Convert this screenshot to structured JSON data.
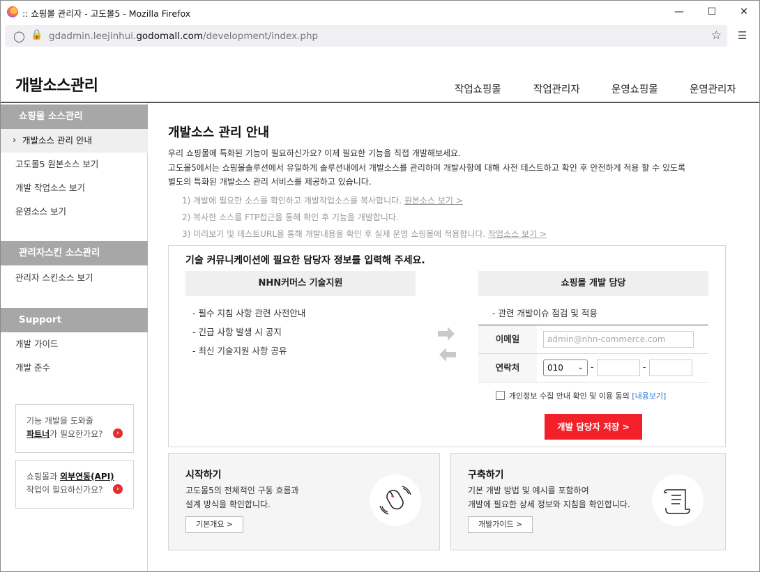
{
  "browser": {
    "window_title": ":: 쇼핑몰 관리자 - 고도몰5 - Mozilla Firefox",
    "url_pre": "gdadmin.leejinhui.",
    "url_domain": "godomall.com",
    "url_post": "/development/index.php"
  },
  "header": {
    "title": "개발소스관리",
    "nav": [
      "작업쇼핑몰",
      "작업관리자",
      "운영쇼핑몰",
      "운영관리자"
    ]
  },
  "sidebar": {
    "section1": "쇼핑몰 소스관리",
    "items1": [
      "개발소스 관리 안내",
      "고도몰5 원본소스 보기",
      "개발 작업소스 보기",
      "운영소스 보기"
    ],
    "section2": "관리자스킨 소스관리",
    "items2": [
      "관리자 스킨소스 보기"
    ],
    "section3": "Support",
    "items3": [
      "개발 가이드",
      "개발 준수"
    ],
    "promo1": {
      "line1": "기능 개발을 도와줄",
      "bold": "파트너",
      "rest": "가 필요한가요?"
    },
    "promo2": {
      "pre": "쇼핑몰과 ",
      "bold": "외부연동(API)",
      "line2": "작업이 필요하신가요?"
    }
  },
  "main": {
    "heading": "개발소스 관리 안내",
    "intro": [
      "우리 쇼핑몰에 특화된 기능이 필요하신가요? 이제 필요한 기능을 직접 개발해보세요.",
      "고도몰5에서는 쇼핑몰솔루션에서 유일하게 솔루션내에서 개발소스를 관리하며 개발사항에 대해 사전 테스트하고 확인 후 안전하게 적용 할 수 있도록",
      "별도의 특화된 개발소스 관리 서비스를 제공하고 있습니다."
    ],
    "steps": [
      {
        "text": "1) 개발에 필요한 소스를 확인하고 개발작업소스를 복사합니다. ",
        "link": "원본소스 보기 >"
      },
      {
        "text": "2) 복사한 소스를 FTP접근을 통해 확인 후 기능을 개발합니다.",
        "link": ""
      },
      {
        "text": "3) 미리보기 및 테스트URL을 통해 개발내용을 확인 후 실제 운영 쇼핑몰에 적용합니다. ",
        "link": "작업소스 보기 >"
      }
    ],
    "contact": {
      "question": "기술 커뮤니케이션에 필요한 담당자 정보를 입력해 주세요.",
      "left_head": "NHN커머스 기술지원",
      "left_bullets": [
        "- 필수 지침 사항 관련 사전안내",
        "- 긴급 사항 발생 시 공지",
        "- 최신 기술지원 사항 공유"
      ],
      "right_head": "쇼핑몰 개발 담당",
      "right_bullet": "- 관련 개발이슈 점검 및 적용",
      "email_label": "이메일",
      "email_placeholder": "admin@nhn-commerce.com",
      "phone_label": "연락처",
      "phone_prefix": "010",
      "consent_text": "개인정보 수집 안내 확인 및 이용 동의 ",
      "consent_link": "[내용보기]",
      "save_label": "개발 담당자 저장 >"
    },
    "cards": [
      {
        "title": "시작하기",
        "lines": [
          "고도몰5의 전체적인 구동 흐름과",
          "설계 방식을 확인합니다."
        ],
        "button": "기본개요 >",
        "icon": "mouse-icon"
      },
      {
        "title": "구축하기",
        "lines": [
          "기본 개발 방법 및 예시를 포함하여",
          "개발에 필요한 상세 정보와 지침을 확인합니다."
        ],
        "button": "개발가이드 >",
        "icon": "scroll-icon"
      }
    ]
  }
}
